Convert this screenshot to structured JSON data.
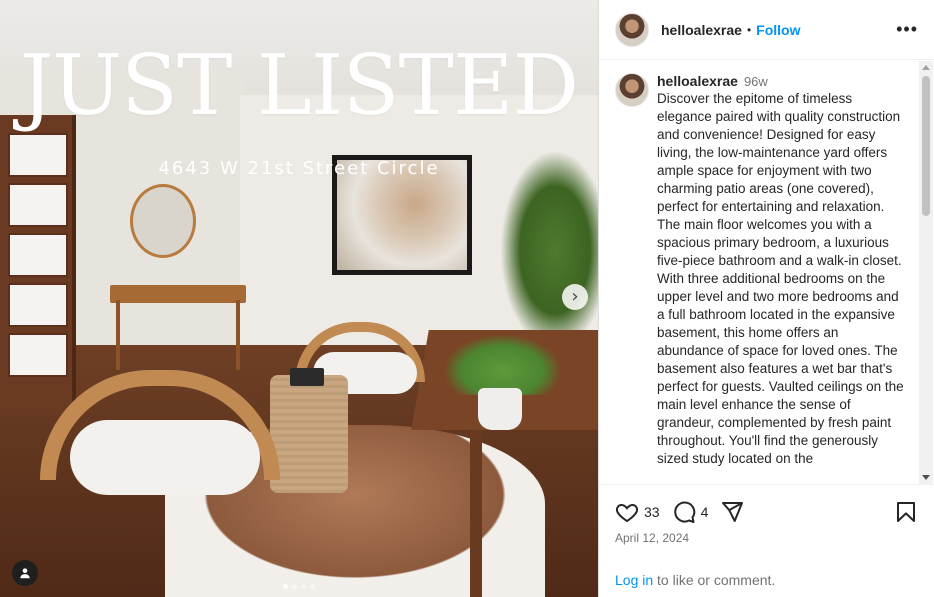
{
  "photo": {
    "headline": "JUST LISTED",
    "address": "4643 W 21st Street Circle",
    "carousel": {
      "total": 4,
      "active_index": 0
    }
  },
  "header": {
    "username": "helloalexrae",
    "separator": "•",
    "follow_label": "Follow",
    "more_label": "•••"
  },
  "caption": {
    "username": "helloalexrae",
    "age": "96w",
    "text": "Discover the epitome of timeless elegance paired with quality construction and convenience! Designed for easy living, the low-maintenance yard offers ample space for enjoyment with two charming patio areas (one covered), perfect for entertaining and relaxation. The main floor welcomes you with a spacious primary bedroom, a luxurious five-piece bathroom and a walk-in closet. With three additional bedrooms on the upper level and two more bedrooms and a full bathroom located in the expansive basement, this home offers an abundance of space for loved ones. The basement also features a wet bar that's perfect for guests. Vaulted ceilings on the main level enhance the sense of grandeur, complemented by fresh paint throughout. You'll find the generously sized study located on the"
  },
  "actions": {
    "likes": "33",
    "comments": "4",
    "date": "April 12, 2024",
    "login_link": "Log in",
    "login_rest": " to like or comment."
  },
  "colors": {
    "accent": "#0095f6",
    "text": "#262626",
    "muted": "#737373"
  },
  "icons": [
    "user-tag-icon",
    "chevron-right-icon",
    "heart-icon",
    "comment-icon",
    "share-icon",
    "bookmark-icon",
    "more-icon"
  ]
}
